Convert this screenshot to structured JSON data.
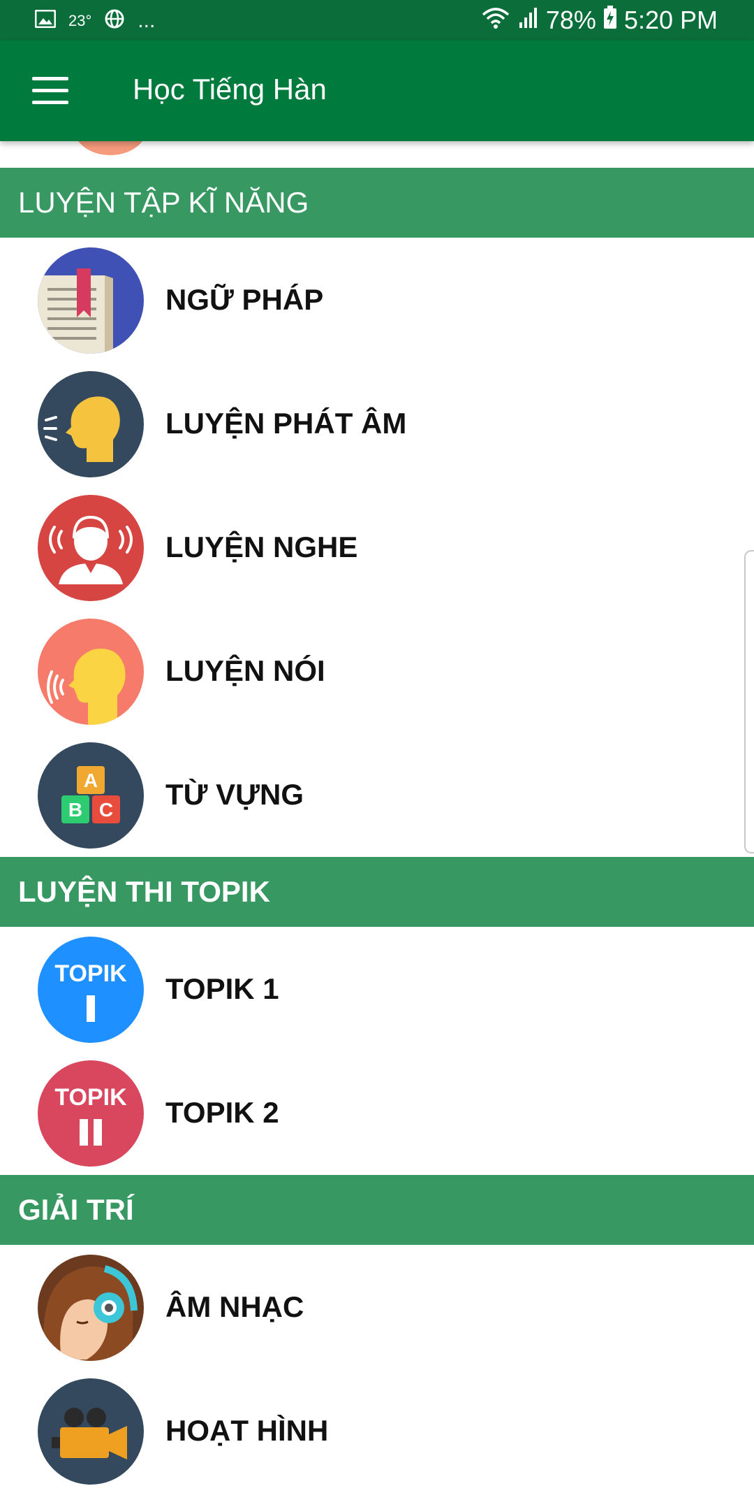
{
  "status_bar": {
    "temperature": "23°",
    "more": "...",
    "battery": "78%",
    "time": "5:20 PM"
  },
  "app_bar": {
    "title": "Học Tiếng Hàn",
    "menu_icon": "hamburger-menu-icon"
  },
  "sections": [
    {
      "title": "LUYỆN TẬP KĨ NĂNG",
      "items": [
        {
          "label": "NGỮ PHÁP",
          "icon": "grammar-book-icon"
        },
        {
          "label": "LUYỆN PHÁT ÂM",
          "icon": "pronunciation-speaking-head-icon"
        },
        {
          "label": "LUYỆN NGHE",
          "icon": "listening-person-icon"
        },
        {
          "label": "LUYỆN NÓI",
          "icon": "speaking-head-icon"
        },
        {
          "label": "TỪ VỰNG",
          "icon": "abc-blocks-icon"
        }
      ]
    },
    {
      "title": "LUYỆN THI TOPIK",
      "items": [
        {
          "label": "TOPIK 1",
          "icon": "topik-1-icon",
          "icon_text": "TOPIK"
        },
        {
          "label": "TOPIK 2",
          "icon": "topik-2-icon",
          "icon_text": "TOPIK"
        }
      ]
    },
    {
      "title": "GIẢI TRÍ",
      "items": [
        {
          "label": "ÂM NHẠC",
          "icon": "music-headphones-girl-icon"
        },
        {
          "label": "HOẠT HÌNH",
          "icon": "video-camera-icon"
        }
      ]
    }
  ],
  "icon_letters": [
    "A",
    "B",
    "C"
  ],
  "colors": {
    "status_bar": "#0b6e3a",
    "app_bar": "#007a3d",
    "section_header": "#379862"
  }
}
